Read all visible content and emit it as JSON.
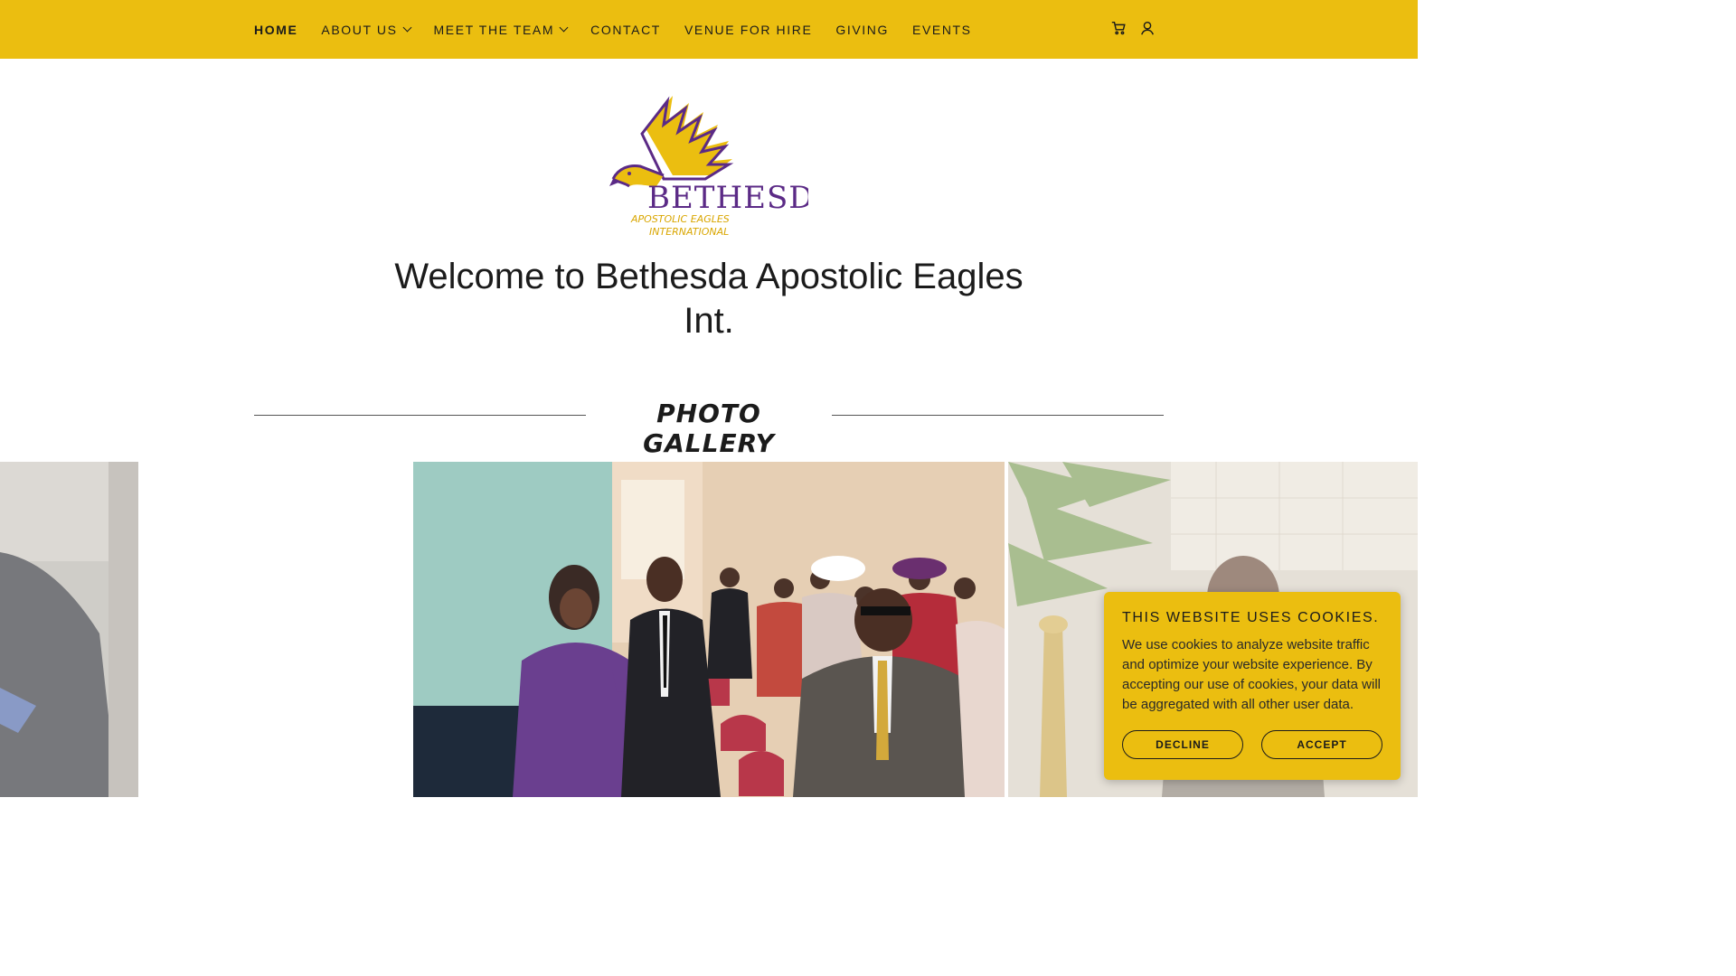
{
  "nav": {
    "items": [
      {
        "label": "HOME",
        "active": true,
        "dropdown": false
      },
      {
        "label": "ABOUT US",
        "active": false,
        "dropdown": true
      },
      {
        "label": "MEET THE TEAM",
        "active": false,
        "dropdown": true
      },
      {
        "label": "CONTACT",
        "active": false,
        "dropdown": false
      },
      {
        "label": "VENUE FOR HIRE",
        "active": false,
        "dropdown": false
      },
      {
        "label": "GIVING",
        "active": false,
        "dropdown": false
      },
      {
        "label": "EVENTS",
        "active": false,
        "dropdown": false
      }
    ],
    "icons": [
      "cart-icon",
      "account-icon"
    ]
  },
  "logo": {
    "name": "BETHESDA",
    "line1": "APOSTOLIC EAGLES",
    "line2": "INTERNATIONAL"
  },
  "hero": {
    "title": "Welcome to Bethesda Apostolic Eagles Int."
  },
  "gallery": {
    "heading": "PHOTO GALLERY"
  },
  "cookie": {
    "title": "THIS WEBSITE USES COOKIES.",
    "text": "We use cookies to analyze website traffic and optimize your website experience. By accepting our use of cookies, your data will be aggregated with all other user data.",
    "decline_label": "DECLINE",
    "accept_label": "ACCEPT"
  },
  "colors": {
    "brand_yellow": "#ebbe10",
    "brand_purple": "#5b2a86",
    "text": "#1b1b1b"
  }
}
